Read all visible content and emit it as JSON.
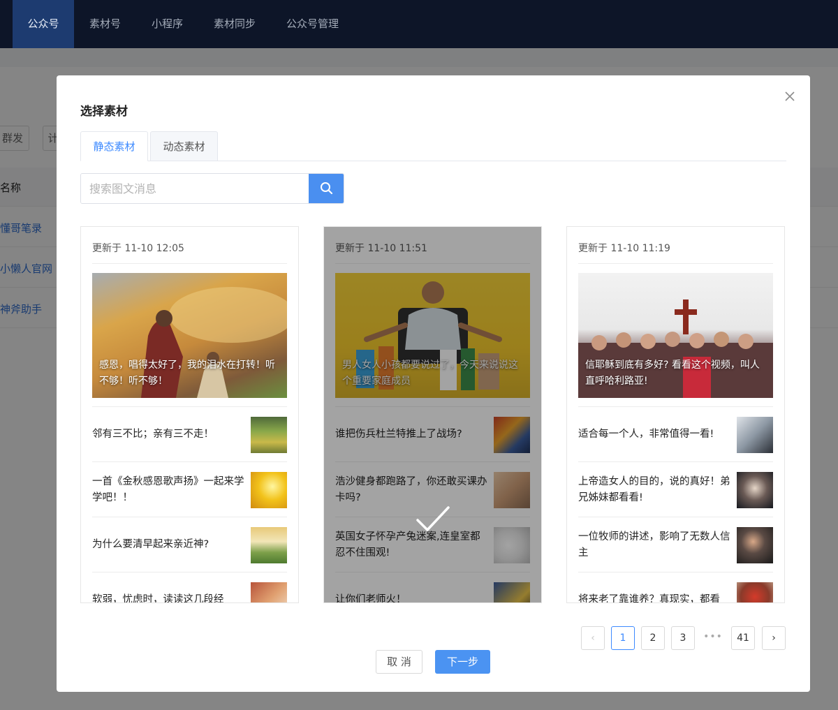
{
  "topnav": {
    "items": [
      "公众号",
      "素材号",
      "小程序",
      "素材同步",
      "公众号管理"
    ],
    "active_index": 0
  },
  "background": {
    "buttons": [
      "群发",
      "计"
    ],
    "table_header": "名称",
    "rows": [
      "懂哥笔录",
      "小懒人官网",
      "神斧助手"
    ]
  },
  "modal": {
    "title": "选择素材",
    "tabs": [
      "静态素材",
      "动态素材"
    ],
    "active_tab": 0,
    "search": {
      "placeholder": "搜索图文消息",
      "value": ""
    },
    "cards": [
      {
        "date": "更新于 11-10 12:05",
        "cover_title": "感恩，唱得太好了，我的泪水在打转！听不够！听不够！",
        "selected": false,
        "items": [
          {
            "title": "邻有三不比；亲有三不走！"
          },
          {
            "title": "一首《金秋感恩歌声扬》一起来学学吧！！"
          },
          {
            "title": "为什么要清早起来亲近神?"
          },
          {
            "title": "软弱，忧虑时，读读这几段经"
          }
        ]
      },
      {
        "date": "更新于 11-10 11:51",
        "cover_title": "男人女人小孩都要说过了，今天来说说这个重要家庭成员",
        "selected": true,
        "items": [
          {
            "title": "谁把伤兵杜兰特推上了战场?"
          },
          {
            "title": "浩沙健身都跑路了，你还敢买课办卡吗?"
          },
          {
            "title": "英国女子怀孕产兔迷案,连皇室都忍不住围观!"
          },
          {
            "title": "让你们老师火！"
          }
        ]
      },
      {
        "date": "更新于 11-10 11:19",
        "cover_title": "信耶稣到底有多好? 看看这个视频，叫人直呼哈利路亚!",
        "selected": false,
        "items": [
          {
            "title": "适合每一个人，非常值得一看!"
          },
          {
            "title": "上帝造女人的目的，说的真好！弟兄姊妹都看看!"
          },
          {
            "title": "一位牧师的讲述，影响了无数人信主"
          },
          {
            "title": "将来老了靠谁养？真现实，都看"
          }
        ]
      }
    ],
    "pagination": {
      "prev": "‹",
      "pages": [
        "1",
        "2",
        "3"
      ],
      "ellipsis": "•••",
      "last": "41",
      "next": "›",
      "current": "1"
    },
    "buttons": {
      "cancel": "取 消",
      "next": "下一步"
    }
  },
  "colors": {
    "primary": "#3d8aff",
    "nav_bg": "#0d1528",
    "nav_active": "#1d3b70"
  }
}
